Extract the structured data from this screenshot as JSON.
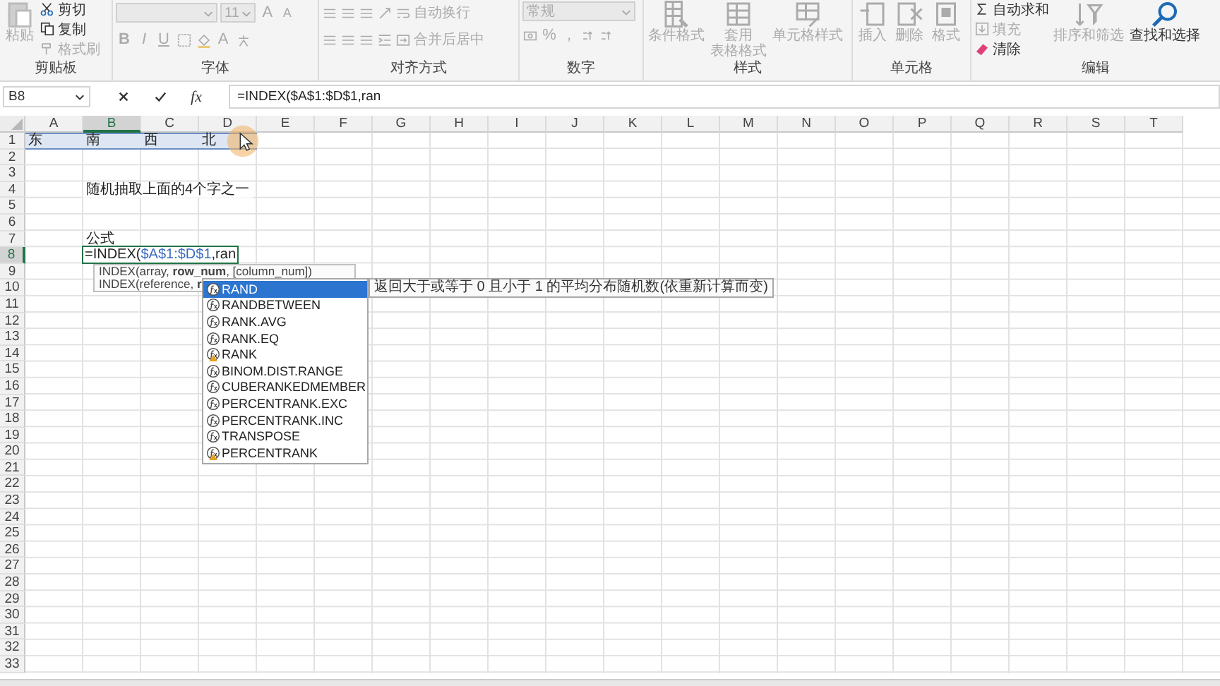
{
  "ribbon": [
    {
      "kind": "clipboard",
      "label": "剪贴板",
      "paste": {
        "label": "粘贴",
        "disabled": true
      },
      "items": [
        {
          "label": "剪切",
          "disabled": false
        },
        {
          "label": "复制",
          "disabled": false
        },
        {
          "label": "格式刷",
          "disabled": true
        }
      ]
    },
    {
      "kind": "font",
      "label": "字体",
      "font_size": "11",
      "grow": "A",
      "shrink": "A",
      "styles": [
        "B",
        "I",
        "U"
      ],
      "font_color": "A",
      "disabled": true
    },
    {
      "kind": "alignment",
      "label": "对齐方式",
      "items": [
        {
          "label": "自动换行",
          "disabled": true
        },
        {
          "label": "合并后居中",
          "disabled": true
        }
      ]
    },
    {
      "kind": "number",
      "label": "数字",
      "format": "常规",
      "symbols": [
        "%",
        ","
      ],
      "disabled": true
    },
    {
      "kind": "styles",
      "label": "样式",
      "items": [
        {
          "lines": [
            "条件格式"
          ],
          "disabled": true
        },
        {
          "lines": [
            "套用",
            "表格格式"
          ],
          "disabled": true
        },
        {
          "lines": [
            "单元格样式"
          ],
          "disabled": true
        }
      ]
    },
    {
      "kind": "cells",
      "label": "单元格",
      "items": [
        {
          "lines": [
            "插入"
          ],
          "disabled": true
        },
        {
          "lines": [
            "删除"
          ],
          "disabled": true
        },
        {
          "lines": [
            "格式"
          ],
          "disabled": true
        }
      ]
    },
    {
      "kind": "editing",
      "label": "编辑",
      "items": [
        {
          "label": "自动求和",
          "disabled": false
        },
        {
          "label": "填充",
          "disabled": true
        },
        {
          "label": "清除",
          "disabled": false
        }
      ],
      "large": [
        {
          "label": "排序和筛选",
          "disabled": true
        },
        {
          "label": "查找和选择",
          "disabled": false
        }
      ]
    }
  ],
  "formula_bar": {
    "name_box": "B8",
    "function_button": "fx",
    "formula": "=INDEX($A$1:$D$1,ran"
  },
  "grid": {
    "columns": [
      {
        "label": "A",
        "selected": false
      },
      {
        "label": "B",
        "selected": true
      },
      {
        "label": "C",
        "selected": false
      },
      {
        "label": "D",
        "selected": false
      },
      {
        "label": "E",
        "selected": false
      },
      {
        "label": "F",
        "selected": false
      },
      {
        "label": "G",
        "selected": false
      },
      {
        "label": "H",
        "selected": false
      },
      {
        "label": "I",
        "selected": false
      },
      {
        "label": "J",
        "selected": false
      },
      {
        "label": "K",
        "selected": false
      },
      {
        "label": "L",
        "selected": false
      },
      {
        "label": "M",
        "selected": false
      },
      {
        "label": "N",
        "selected": false
      },
      {
        "label": "O",
        "selected": false
      },
      {
        "label": "P",
        "selected": false
      },
      {
        "label": "Q",
        "selected": false
      },
      {
        "label": "R",
        "selected": false
      },
      {
        "label": "S",
        "selected": false
      },
      {
        "label": "T",
        "selected": false
      }
    ],
    "rows": [
      {
        "label": "1",
        "selected": false,
        "cells": [
          {
            "text": "东",
            "selected": true
          },
          {
            "text": "南",
            "selected": true
          },
          {
            "text": "西",
            "selected": true
          },
          {
            "text": "北",
            "selected": true
          }
        ]
      },
      {
        "label": "2",
        "selected": false
      },
      {
        "label": "3",
        "selected": false
      },
      {
        "label": "4",
        "selected": false,
        "cells": [
          null,
          {
            "text": "随机抽取上面的4个字之一",
            "selected": false
          }
        ]
      },
      {
        "label": "5",
        "selected": false
      },
      {
        "label": "6",
        "selected": false
      },
      {
        "label": "7",
        "selected": false,
        "cells": [
          null,
          {
            "text": "公式",
            "selected": false
          }
        ]
      },
      {
        "label": "8",
        "selected": true,
        "cells": [
          null,
          {
            "kind": "editor",
            "parts": [
              {
                "text": "=INDEX(",
                "kind": "plain"
              },
              {
                "text": "$A$1:$D$1",
                "kind": "reference"
              },
              {
                "text": ",ran",
                "kind": "plain"
              }
            ]
          }
        ]
      },
      {
        "label": "9",
        "selected": false
      },
      {
        "label": "10",
        "selected": false
      },
      {
        "label": "11",
        "selected": false
      },
      {
        "label": "12",
        "selected": false
      },
      {
        "label": "13",
        "selected": false
      },
      {
        "label": "14",
        "selected": false
      },
      {
        "label": "15",
        "selected": false
      },
      {
        "label": "16",
        "selected": false
      },
      {
        "label": "17",
        "selected": false
      },
      {
        "label": "18",
        "selected": false
      },
      {
        "label": "19",
        "selected": false
      },
      {
        "label": "20",
        "selected": false
      },
      {
        "label": "21",
        "selected": false
      },
      {
        "label": "22",
        "selected": false
      },
      {
        "label": "23",
        "selected": false
      },
      {
        "label": "24",
        "selected": false
      },
      {
        "label": "25",
        "selected": false
      },
      {
        "label": "26",
        "selected": false
      },
      {
        "label": "27",
        "selected": false
      },
      {
        "label": "28",
        "selected": false
      },
      {
        "label": "29",
        "selected": false
      },
      {
        "label": "30",
        "selected": false
      },
      {
        "label": "31",
        "selected": false
      },
      {
        "label": "32",
        "selected": false
      },
      {
        "label": "33",
        "selected": false
      }
    ]
  },
  "argument_hint": {
    "lines": [
      "INDEX(array, **row_num**, [column_num])",
      "INDEX(reference, **r**"
    ]
  },
  "autocomplete": {
    "items": [
      {
        "name": "RAND",
        "kind": "function",
        "selected": true
      },
      {
        "name": "RANDBETWEEN",
        "kind": "function",
        "selected": false
      },
      {
        "name": "RANK.AVG",
        "kind": "function",
        "selected": false
      },
      {
        "name": "RANK.EQ",
        "kind": "function",
        "selected": false
      },
      {
        "name": "RANK",
        "kind": "compatibility",
        "selected": false
      },
      {
        "name": "BINOM.DIST.RANGE",
        "kind": "function",
        "selected": false
      },
      {
        "name": "CUBERANKEDMEMBER",
        "kind": "function",
        "selected": false
      },
      {
        "name": "PERCENTRANK.EXC",
        "kind": "function",
        "selected": false
      },
      {
        "name": "PERCENTRANK.INC",
        "kind": "function",
        "selected": false
      },
      {
        "name": "TRANSPOSE",
        "kind": "function",
        "selected": false
      },
      {
        "name": "PERCENTRANK",
        "kind": "compatibility",
        "selected": false
      }
    ],
    "description": "返回大于或等于 0 且小于 1 的平均分布随机数(依重新计算而变)"
  }
}
